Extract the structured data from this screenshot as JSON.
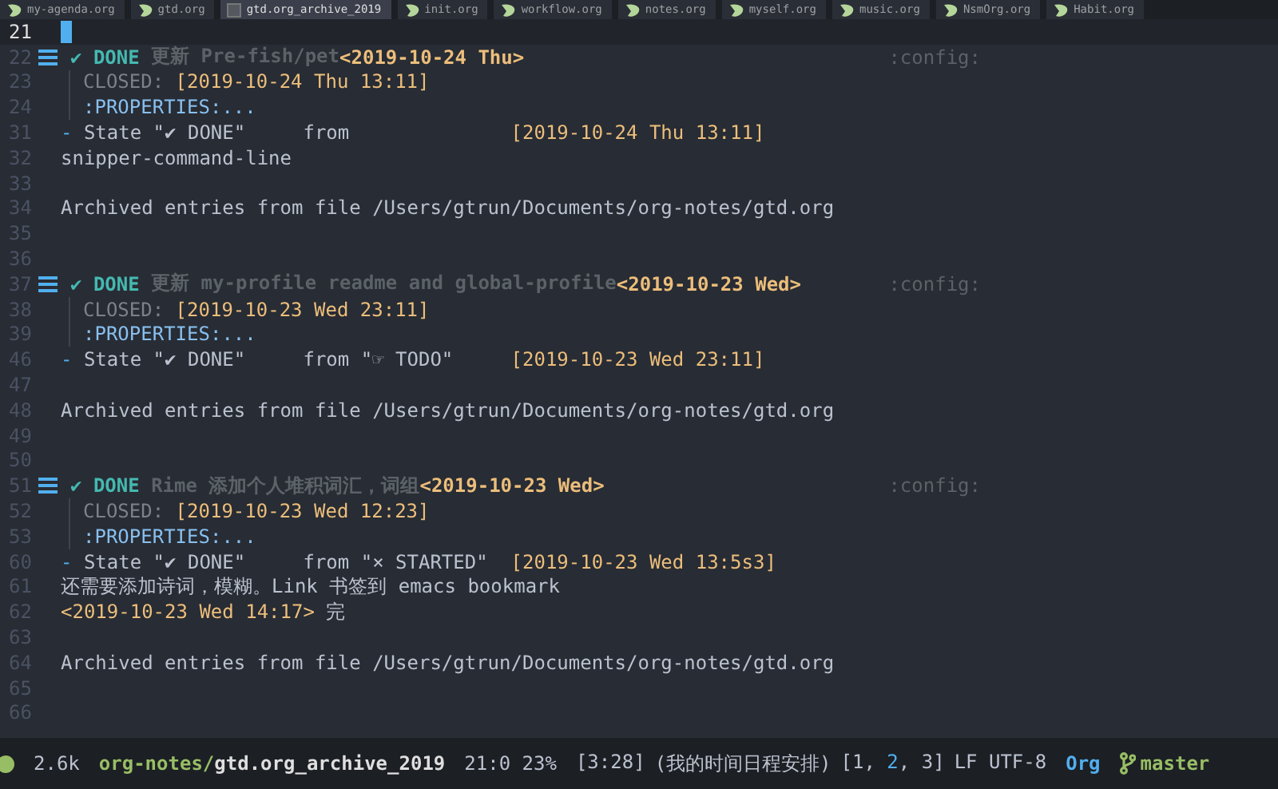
{
  "tabs": [
    {
      "label": "my-agenda.org",
      "selected": false
    },
    {
      "label": "gtd.org",
      "selected": false
    },
    {
      "label": "gtd.org_archive_2019",
      "selected": true
    },
    {
      "label": "init.org",
      "selected": false
    },
    {
      "label": "workflow.org",
      "selected": false
    },
    {
      "label": "notes.org",
      "selected": false
    },
    {
      "label": "myself.org",
      "selected": false
    },
    {
      "label": "music.org",
      "selected": false
    },
    {
      "label": "NsmOrg.org",
      "selected": false
    },
    {
      "label": "Habit.org",
      "selected": false
    }
  ],
  "lines": [
    {
      "number": "21",
      "kind": "current"
    },
    {
      "number": "22",
      "kind": "heading",
      "segments": [
        {
          "kind": "done",
          "text": "✔ DONE"
        },
        {
          "kind": "heading",
          "text": " 更新 Pre-fish/pet"
        },
        {
          "kind": "date-bold",
          "text": "<2019-10-24 Thu>"
        }
      ],
      "tag": ":config:"
    },
    {
      "number": "23",
      "kind": "drawer",
      "segments": [
        {
          "kind": "closed",
          "text": "CLOSED: "
        },
        {
          "kind": "date",
          "text": "[2019-10-24 Thu 13:11]"
        }
      ]
    },
    {
      "number": "24",
      "kind": "drawer",
      "segments": [
        {
          "kind": "drawer",
          "text": ":PROPERTIES:..."
        }
      ]
    },
    {
      "number": "31",
      "kind": "text",
      "segments": [
        {
          "kind": "bullet",
          "text": "- "
        },
        {
          "kind": "text",
          "text": "State \"✔ DONE\"     from              "
        },
        {
          "kind": "date",
          "text": "[2019-10-24 Thu 13:11]"
        }
      ]
    },
    {
      "number": "32",
      "kind": "text",
      "segments": [
        {
          "kind": "text",
          "text": "snipper-command-line"
        }
      ]
    },
    {
      "number": "33",
      "kind": "blank"
    },
    {
      "number": "34",
      "kind": "text",
      "segments": [
        {
          "kind": "text",
          "text": "Archived entries from file /Users/gtrun/Documents/org-notes/gtd.org"
        }
      ]
    },
    {
      "number": "35",
      "kind": "blank"
    },
    {
      "number": "36",
      "kind": "blank"
    },
    {
      "number": "37",
      "kind": "heading",
      "segments": [
        {
          "kind": "done",
          "text": "✔ DONE"
        },
        {
          "kind": "heading",
          "text": " 更新 my-profile readme and global-profile"
        },
        {
          "kind": "date-bold",
          "text": "<2019-10-23 Wed>"
        }
      ],
      "tag": ":config:"
    },
    {
      "number": "38",
      "kind": "drawer",
      "segments": [
        {
          "kind": "closed",
          "text": "CLOSED: "
        },
        {
          "kind": "date",
          "text": "[2019-10-23 Wed 23:11]"
        }
      ]
    },
    {
      "number": "39",
      "kind": "drawer",
      "segments": [
        {
          "kind": "drawer",
          "text": ":PROPERTIES:..."
        }
      ]
    },
    {
      "number": "46",
      "kind": "text",
      "segments": [
        {
          "kind": "bullet",
          "text": "- "
        },
        {
          "kind": "text",
          "text": "State \"✔ DONE\"     from \"☞ TODO\"     "
        },
        {
          "kind": "date",
          "text": "[2019-10-23 Wed 23:11]"
        }
      ]
    },
    {
      "number": "47",
      "kind": "blank"
    },
    {
      "number": "48",
      "kind": "text",
      "segments": [
        {
          "kind": "text",
          "text": "Archived entries from file /Users/gtrun/Documents/org-notes/gtd.org"
        }
      ]
    },
    {
      "number": "49",
      "kind": "blank"
    },
    {
      "number": "50",
      "kind": "blank"
    },
    {
      "number": "51",
      "kind": "heading",
      "segments": [
        {
          "kind": "done",
          "text": "✔ DONE"
        },
        {
          "kind": "heading",
          "text": " Rime 添加个人堆积词汇，词组"
        },
        {
          "kind": "date-bold",
          "text": "<2019-10-23 Wed>"
        }
      ],
      "tag": ":config:"
    },
    {
      "number": "52",
      "kind": "drawer",
      "segments": [
        {
          "kind": "closed",
          "text": "CLOSED: "
        },
        {
          "kind": "date",
          "text": "[2019-10-23 Wed 12:23]"
        }
      ]
    },
    {
      "number": "53",
      "kind": "drawer",
      "segments": [
        {
          "kind": "drawer",
          "text": ":PROPERTIES:..."
        }
      ]
    },
    {
      "number": "60",
      "kind": "text",
      "segments": [
        {
          "kind": "bullet",
          "text": "- "
        },
        {
          "kind": "text",
          "text": "State \"✔ DONE\"     from \"× STARTED\"  "
        },
        {
          "kind": "date",
          "text": "[2019-10-23 Wed 13:5s3]"
        }
      ]
    },
    {
      "number": "61",
      "kind": "text",
      "segments": [
        {
          "kind": "text",
          "text": "还需要添加诗词，模糊。Link 书签到 emacs bookmark"
        }
      ]
    },
    {
      "number": "62",
      "kind": "text",
      "segments": [
        {
          "kind": "date",
          "text": "<2019-10-23 Wed 14:17>"
        },
        {
          "kind": "text",
          "text": " 完"
        }
      ]
    },
    {
      "number": "63",
      "kind": "blank"
    },
    {
      "number": "64",
      "kind": "text",
      "segments": [
        {
          "kind": "text",
          "text": "Archived entries from file /Users/gtrun/Documents/org-notes/gtd.org"
        }
      ]
    },
    {
      "number": "65",
      "kind": "blank"
    },
    {
      "number": "66",
      "kind": "blank"
    }
  ],
  "status_bar": {
    "size": "2.6k",
    "directory": "org-notes/",
    "file": "gtd.org_archive_2019",
    "position": "21:0 23%",
    "clock": "[3:28]",
    "task": "(我的时间日程安排)",
    "workspaces": [
      {
        "text": "[1, ",
        "selected": false
      },
      {
        "text": "2",
        "selected": true
      },
      {
        "text": ", 3]",
        "selected": false
      }
    ],
    "encoding": "LF UTF-8",
    "mode": "Org",
    "branch": "master"
  }
}
